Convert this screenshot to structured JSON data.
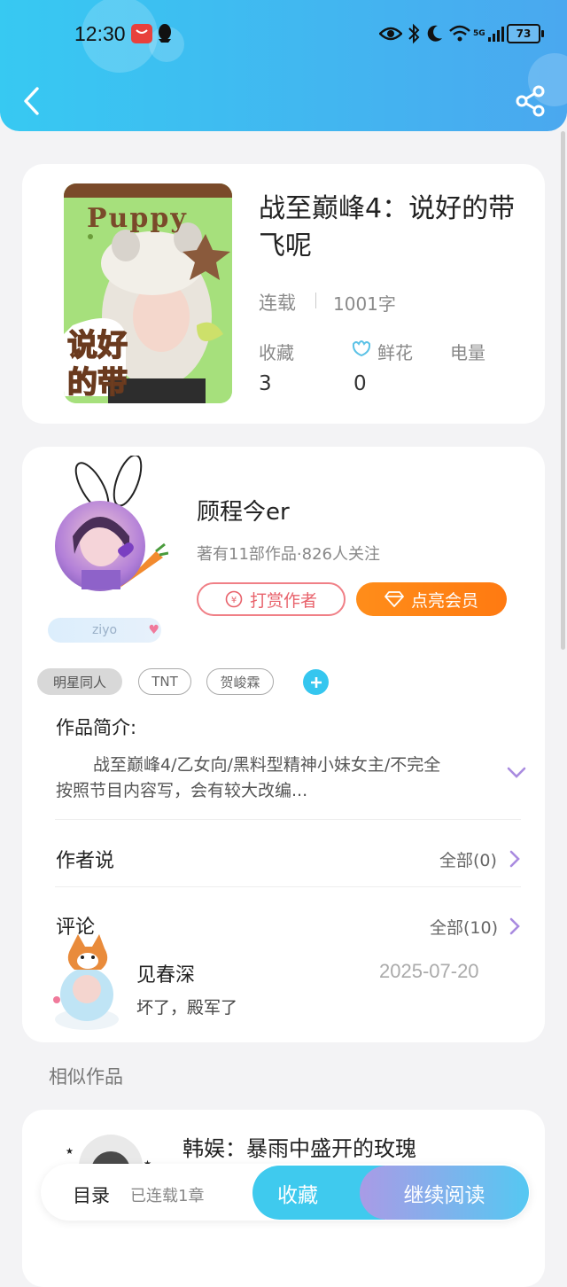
{
  "status_bar": {
    "time": "12:30",
    "battery": "73",
    "network": "5G"
  },
  "book": {
    "title": "战至巅峰4：说好的带飞呢",
    "status": "连载",
    "word_count": "1001字",
    "stats": {
      "favorites_label": "收藏",
      "favorites_value": "3",
      "flowers_label": "鲜花",
      "flowers_value": "0",
      "power_label": "电量"
    },
    "cover_text": {
      "top": "Puppy",
      "main": "说好的带飞呢"
    }
  },
  "author": {
    "name": "顾程今er",
    "meta": "著有11部作品·826人关注",
    "badge": "ziyo",
    "tip_button": "打赏作者",
    "vip_button": "点亮会员"
  },
  "tags": [
    "明星同人",
    "TNT",
    "贺峻霖"
  ],
  "intro": {
    "label": "作品简介:",
    "text_line1": "战至巅峰4/乙女向/黑料型精神小妹女主/不完全",
    "text_line2": "按照节目内容写，会有较大改编..."
  },
  "author_says": {
    "label": "作者说",
    "all": "全部(0)"
  },
  "comments": {
    "label": "评论",
    "all": "全部(10)",
    "items": [
      {
        "user": "见春深",
        "date": "2025-07-20",
        "text": "坏了，殿军了"
      }
    ]
  },
  "similar": {
    "label": "相似作品",
    "first_title": "韩娱：暴雨中盛开的玫瑰"
  },
  "bottom_bar": {
    "toc": "目录",
    "progress": "已连载1章",
    "favorite": "收藏",
    "continue": "继续阅读"
  }
}
